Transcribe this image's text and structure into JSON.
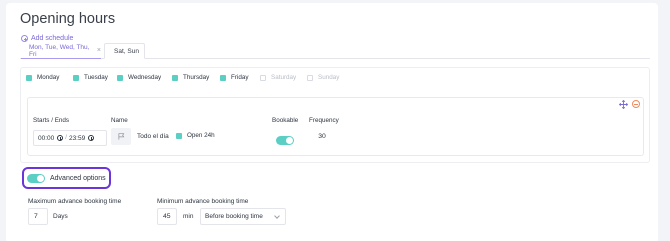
{
  "page": {
    "title": "Opening hours"
  },
  "add_schedule_label": "Add schedule",
  "tabs": [
    {
      "label": "Mon, Tue, Wed, Thu, Fri",
      "active": true,
      "close": "×"
    },
    {
      "label": "Sat, Sun",
      "active": false
    }
  ],
  "days": [
    {
      "label": "Monday",
      "checked": true
    },
    {
      "label": "Tuesday",
      "checked": true
    },
    {
      "label": "Wednesday",
      "checked": true
    },
    {
      "label": "Thursday",
      "checked": true
    },
    {
      "label": "Friday",
      "checked": true
    },
    {
      "label": "Saturday",
      "checked": false
    },
    {
      "label": "Sunday",
      "checked": false
    }
  ],
  "slot": {
    "starts_ends_label": "Starts / Ends",
    "start_time": "00:00",
    "separator": "/",
    "end_time": "23:59",
    "name_label": "Name",
    "name_value": "Todo el día",
    "open24_label": "Open 24h",
    "open24_checked": true,
    "bookable_label": "Bookable",
    "bookable_on": true,
    "frequency_label": "Frequency",
    "frequency_value": "30"
  },
  "advanced": {
    "label": "Advanced options",
    "enabled": true,
    "max_label": "Maximum advance booking time",
    "max_value": "7",
    "max_unit": "Days",
    "min_label": "Minimum advance booking time",
    "min_value": "45",
    "min_unit": "min",
    "min_reference": "Before booking time"
  },
  "colors": {
    "accent": "#7a6ad6",
    "teal": "#5ccfc5",
    "highlight": "#6b35d9",
    "danger": "#f08a5d"
  }
}
